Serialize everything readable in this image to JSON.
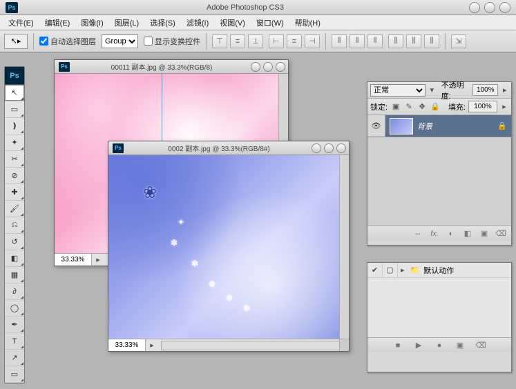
{
  "app": {
    "title": "Adobe Photoshop CS3",
    "logo": "Ps"
  },
  "menus": [
    "文件(E)",
    "编辑(E)",
    "图像(I)",
    "图层(L)",
    "选择(S)",
    "滤镜(I)",
    "视图(V)",
    "窗口(W)",
    "帮助(H)"
  ],
  "options": {
    "auto_select_label": "自动选择图层",
    "auto_select_checked": true,
    "group_select_value": "Group",
    "show_transform_label": "显示变换控件",
    "show_transform_checked": false
  },
  "tools": [
    {
      "name": "move-tool",
      "glyph": "↖"
    },
    {
      "name": "marquee-tool",
      "glyph": "▭"
    },
    {
      "name": "lasso-tool",
      "glyph": "❫"
    },
    {
      "name": "magic-wand-tool",
      "glyph": "✦"
    },
    {
      "name": "crop-tool",
      "glyph": "✂"
    },
    {
      "name": "slice-tool",
      "glyph": "⊘"
    },
    {
      "name": "healing-brush-tool",
      "glyph": "✚"
    },
    {
      "name": "brush-tool",
      "glyph": "🖌"
    },
    {
      "name": "stamp-tool",
      "glyph": "⎌"
    },
    {
      "name": "history-brush-tool",
      "glyph": "↺"
    },
    {
      "name": "eraser-tool",
      "glyph": "◧"
    },
    {
      "name": "gradient-tool",
      "glyph": "▦"
    },
    {
      "name": "blur-tool",
      "glyph": "∂"
    },
    {
      "name": "dodge-tool",
      "glyph": "◯"
    },
    {
      "name": "pen-tool",
      "glyph": "✒"
    },
    {
      "name": "type-tool",
      "glyph": "T"
    },
    {
      "name": "path-select-tool",
      "glyph": "↗"
    },
    {
      "name": "shape-tool",
      "glyph": "▭"
    }
  ],
  "documents": [
    {
      "title": "00011 副本.jpg @ 33.3%(RGB/8)",
      "zoom": "33.33%"
    },
    {
      "title": "0002 副本.jpg @ 33.3%(RGB/8#)",
      "zoom": "33.33%"
    }
  ],
  "layers_panel": {
    "blend_mode": "正常",
    "opacity_label": "不透明度:",
    "opacity_value": "100%",
    "lock_label": "锁定:",
    "fill_label": "填充:",
    "fill_value": "100%",
    "layers": [
      {
        "name": "背景",
        "locked": true
      }
    ],
    "footer_icons": [
      "⇔",
      "fx.",
      "◐",
      "◧",
      "▣",
      "⌫"
    ]
  },
  "actions_panel": {
    "default_set": "默认动作",
    "footer_icons": [
      "■",
      "▶",
      "●",
      "▣",
      "⌫"
    ]
  }
}
